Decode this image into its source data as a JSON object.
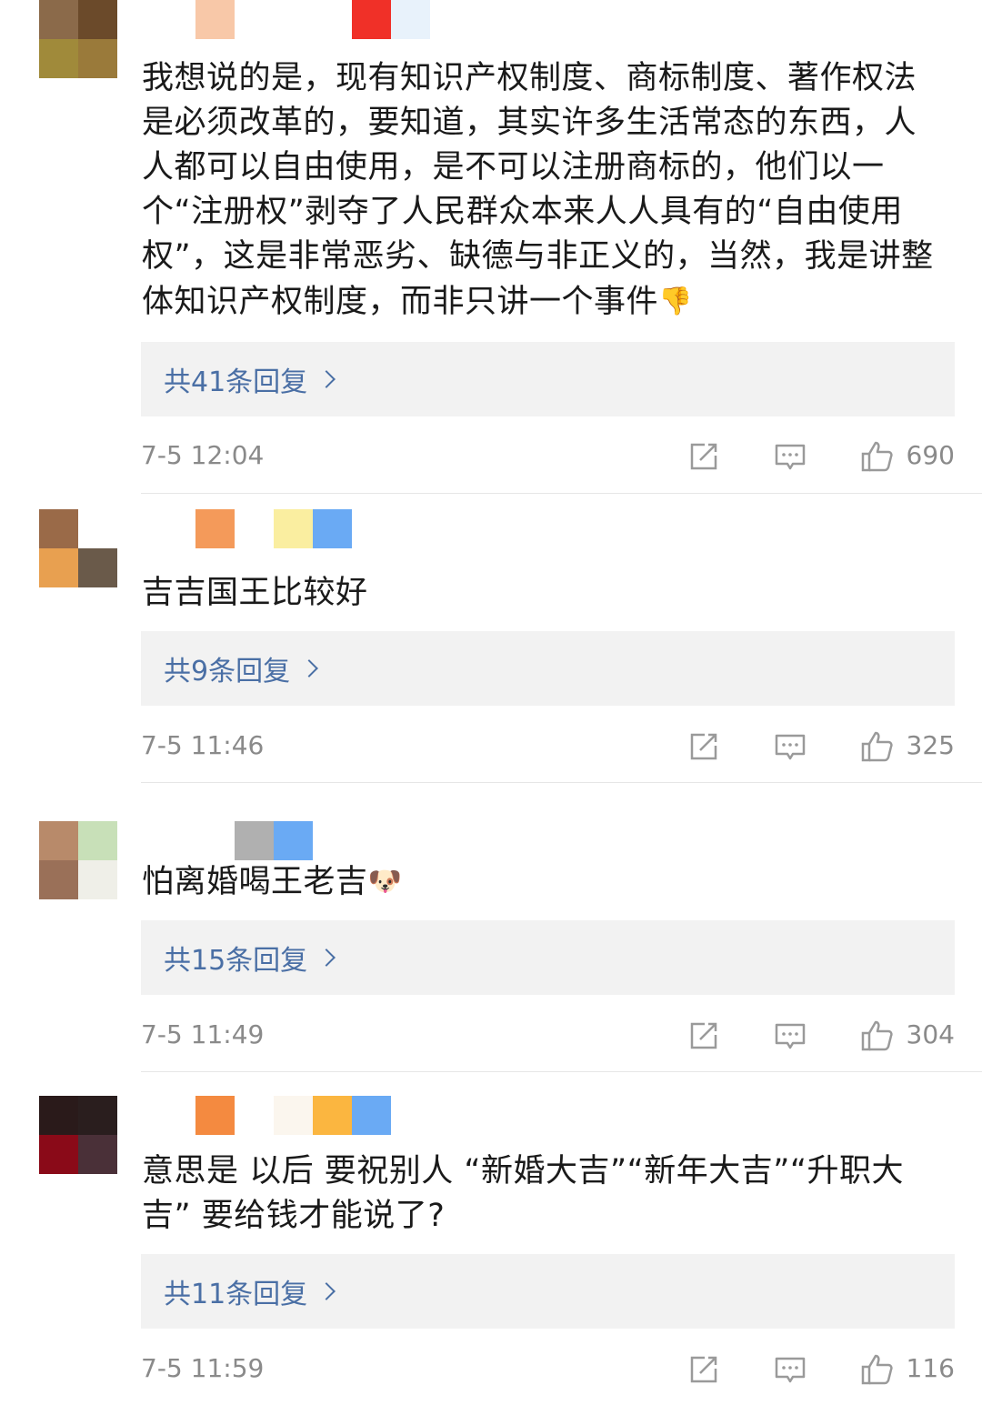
{
  "comments": [
    {
      "avatar_colors": [
        "#8b6a4a",
        "#6b4a2a",
        "#a08a3a",
        "#9a7a3a"
      ],
      "name_colors": [
        "#f8c8a8",
        "",
        "",
        "",
        "#f03028",
        "#e8f2fb"
      ],
      "text": "我想说的是，现有知识产权制度、商标制度、著作权法是必须改革的，要知道，其实许多生活常态的东西，人人都可以自由使用，是不可以注册商标的，他们以一个“注册权”剥夺了人民群众本来人人具有的“自由使用权”，这是非常恶劣、缺德与非正义的，当然，我是讲整体知识产权制度，而非只讲一个事件",
      "emoji": "👎",
      "reply_label": "共41条回复",
      "time": "7-5 12:04",
      "likes": "690"
    },
    {
      "avatar_colors": [
        "#9a6a48",
        "#ffffff",
        "#e8a050",
        "#6a5a4a"
      ],
      "name_colors": [
        "#f49a5a",
        "",
        "#faeea0",
        "#6aaaf4"
      ],
      "text": "吉吉国王比较好",
      "emoji": "",
      "reply_label": "共9条回复",
      "time": "7-5 11:46",
      "likes": "325"
    },
    {
      "avatar_colors": [
        "#b88a6a",
        "#c8e0b8",
        "#9a7058",
        "#efefe8"
      ],
      "name_colors": [
        "",
        "#b0b0b0",
        "#6aaaf4"
      ],
      "text": "怕离婚喝王老吉",
      "emoji": "🐶",
      "reply_label": "共15条回复",
      "time": "7-5 11:49",
      "likes": "304"
    },
    {
      "avatar_colors": [
        "#2a1a1a",
        "#2a1e1e",
        "#8a0a18",
        "#4a3038"
      ],
      "name_colors": [
        "#f48a40",
        "",
        "#fbf6ee",
        "#fbb640",
        "#6aaaf4"
      ],
      "text": "意思是 以后 要祝别人 “新婚大吉”“新年大吉”“升职大吉” 要给钱才能说了?",
      "emoji": "",
      "reply_label": "共11条回复",
      "time": "7-5 11:59",
      "likes": "116"
    }
  ],
  "icons": {
    "share": "share-edit-icon",
    "reply": "comment-bubble-icon",
    "like": "thumbs-up-icon"
  }
}
